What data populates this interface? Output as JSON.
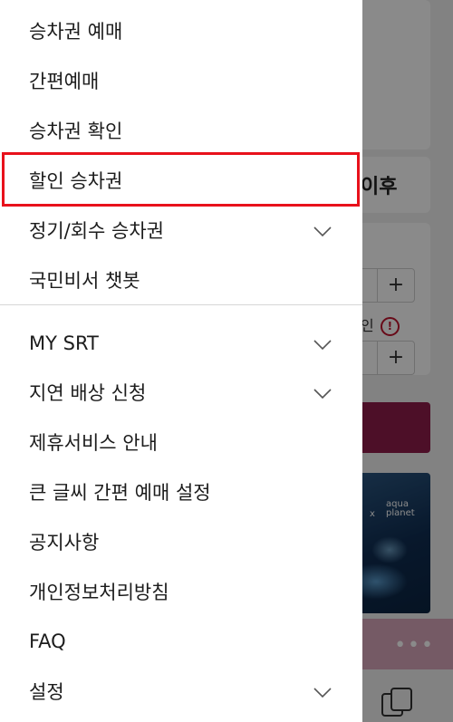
{
  "menu": {
    "group1": [
      {
        "label": "승차권 예매"
      },
      {
        "label": "간편예매"
      },
      {
        "label": "승차권 확인"
      },
      {
        "label": "할인 승차권"
      },
      {
        "label": "정기/회수 승차권"
      },
      {
        "label": "국민비서 챗봇"
      }
    ],
    "group2": [
      {
        "label": "MY SRT"
      },
      {
        "label": "지연 배상 신청"
      },
      {
        "label": "제휴서비스 안내"
      },
      {
        "label": "큰 글씨 간편 예매 설정"
      },
      {
        "label": "공지사항"
      },
      {
        "label": "개인정보처리방침"
      },
      {
        "label": "FAQ"
      },
      {
        "label": "설정"
      }
    ]
  },
  "background": {
    "date_fragment": "이후",
    "stepper_plus": "+",
    "discount_fragment": "인",
    "warning_mark": "!",
    "banner_logo": "aqua planet",
    "banner_x": "x",
    "more_dots": "•••"
  },
  "colors": {
    "highlight": "#e8111b",
    "brand": "#8e1c4b"
  }
}
